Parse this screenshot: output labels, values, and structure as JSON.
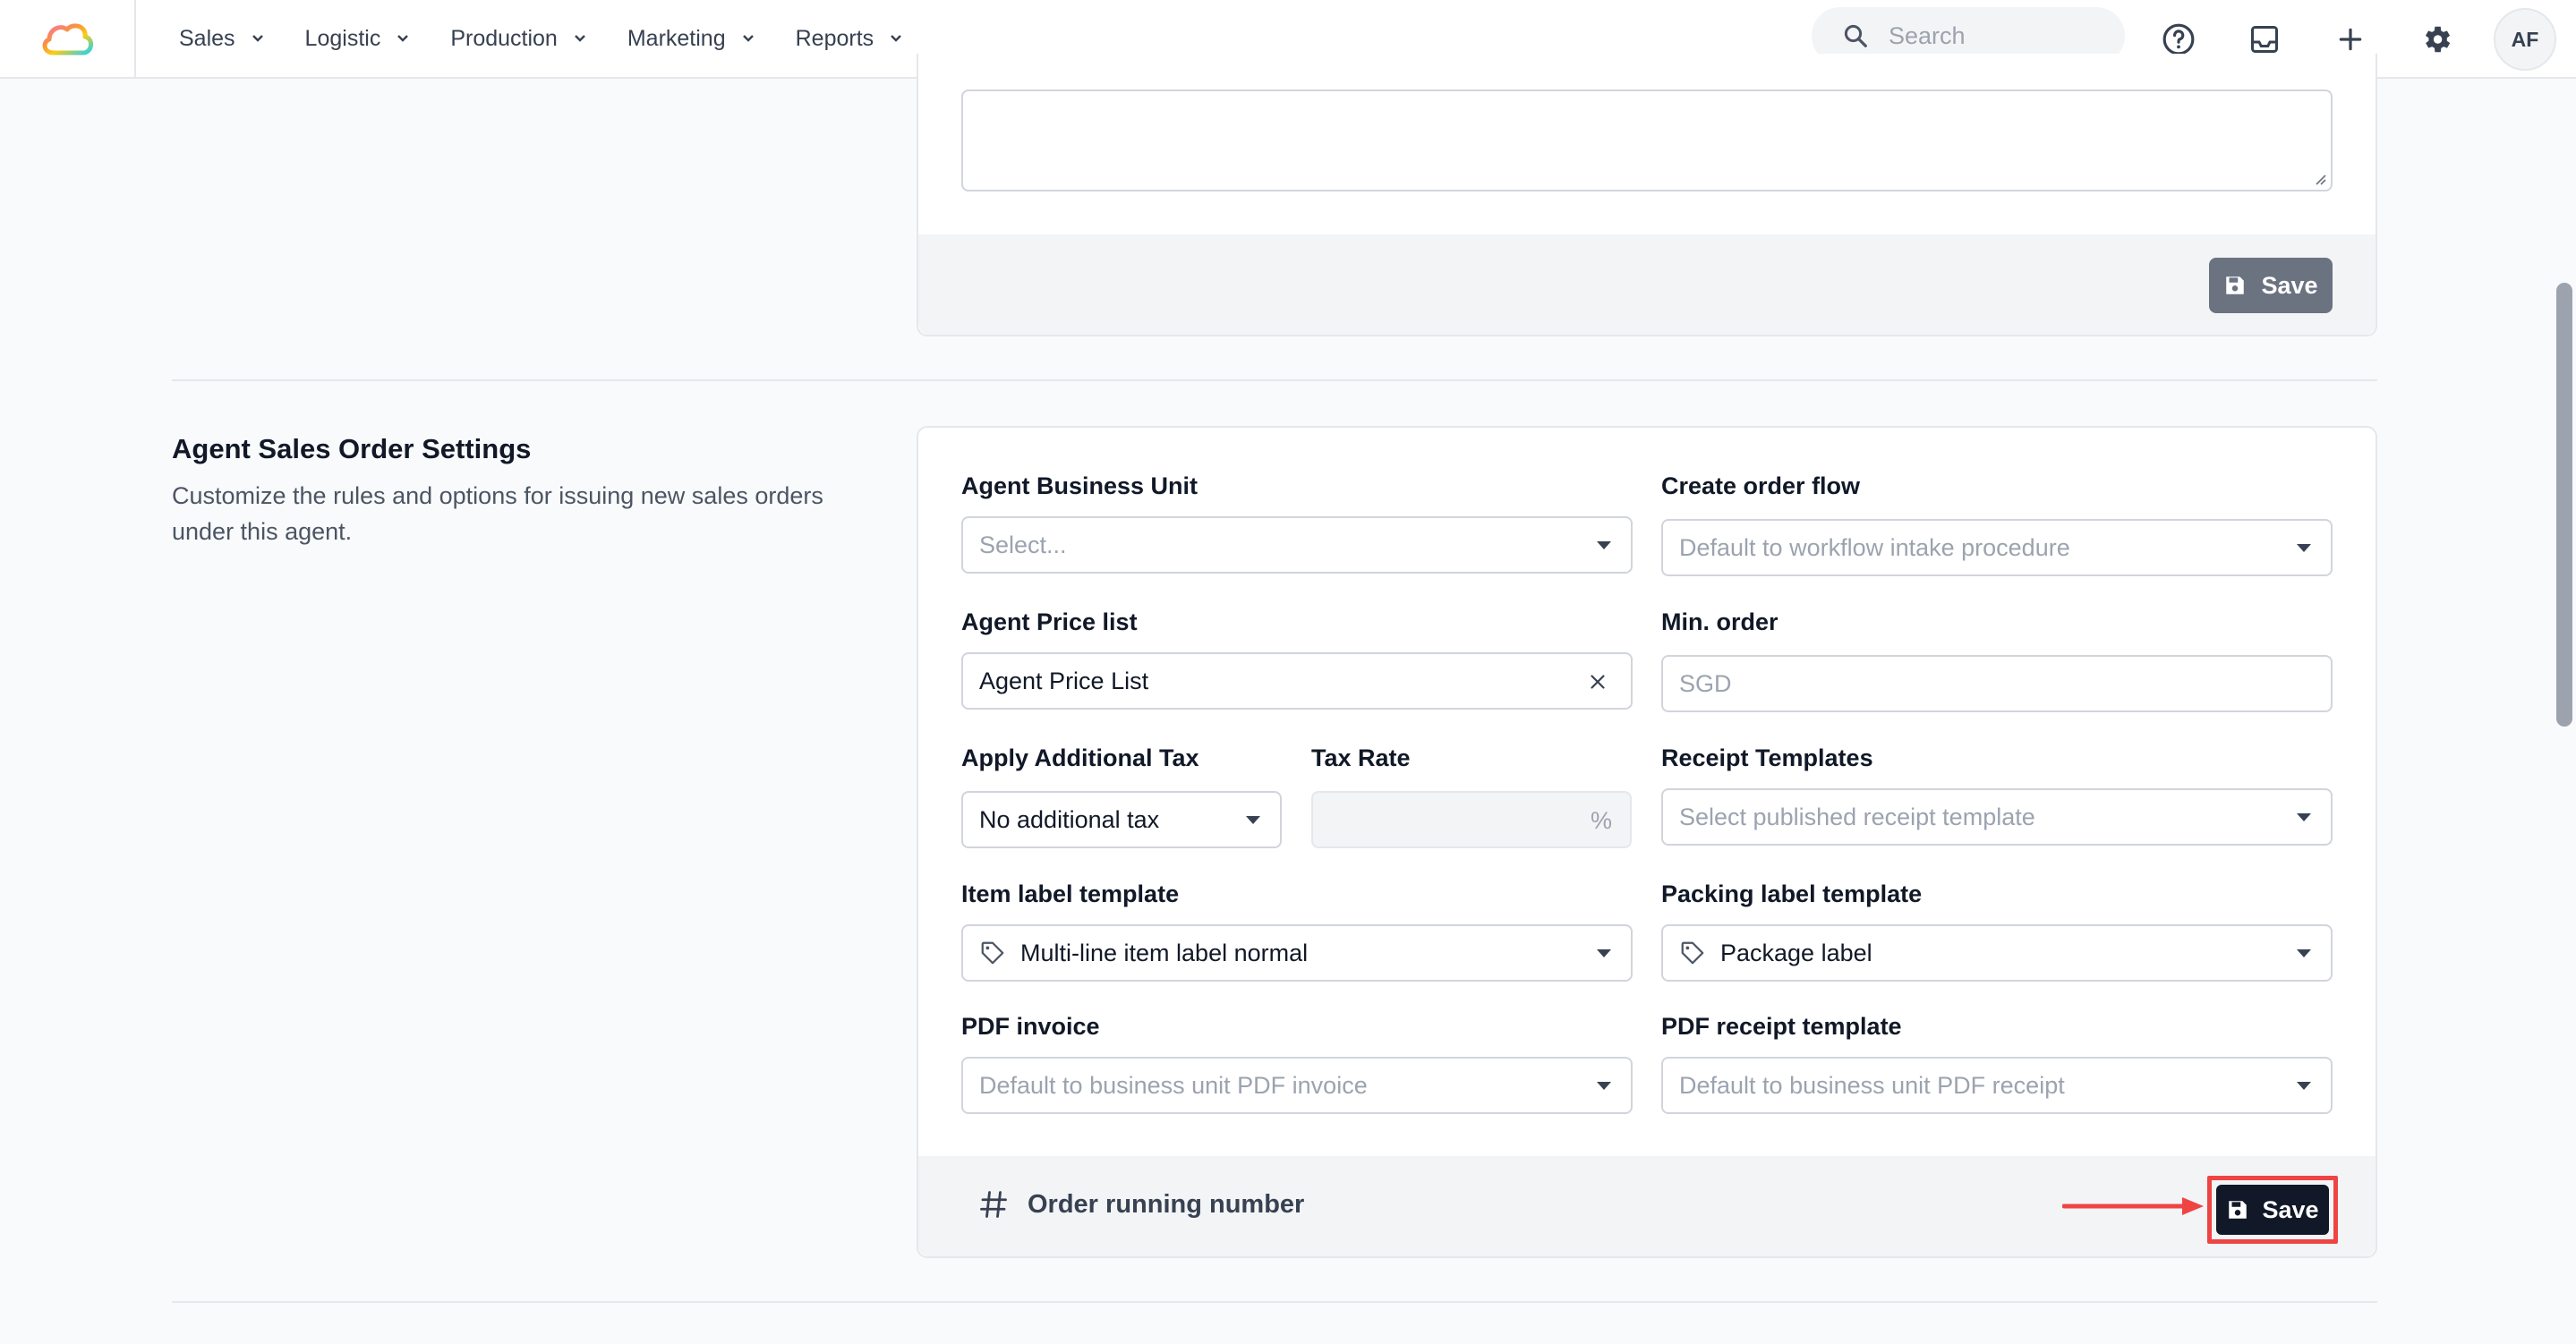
{
  "nav": {
    "items": [
      {
        "label": "Sales"
      },
      {
        "label": "Logistic"
      },
      {
        "label": "Production"
      },
      {
        "label": "Marketing"
      },
      {
        "label": "Reports"
      }
    ],
    "search_placeholder": "Search",
    "avatar_initials": "AF"
  },
  "top_card": {
    "save_label": "Save"
  },
  "section": {
    "title": "Agent Sales Order Settings",
    "description": "Customize the rules and options for issuing new sales orders under this agent."
  },
  "form": {
    "agent_business_unit": {
      "label": "Agent Business Unit",
      "placeholder": "Select..."
    },
    "create_order_flow": {
      "label": "Create order flow",
      "placeholder": "Default to workflow intake procedure"
    },
    "agent_price_list": {
      "label": "Agent Price list",
      "value": "Agent Price List"
    },
    "min_order": {
      "label": "Min. order",
      "placeholder": "SGD"
    },
    "apply_additional_tax": {
      "label": "Apply Additional Tax",
      "value": "No additional tax"
    },
    "tax_rate": {
      "label": "Tax Rate",
      "suffix": "%"
    },
    "receipt_templates": {
      "label": "Receipt Templates",
      "placeholder": "Select published receipt template"
    },
    "item_label_template": {
      "label": "Item label template",
      "value": "Multi-line item label normal"
    },
    "packing_label_template": {
      "label": "Packing label template",
      "value": "Package label"
    },
    "pdf_invoice": {
      "label": "PDF invoice",
      "placeholder": "Default to business unit PDF invoice"
    },
    "pdf_receipt_template": {
      "label": "PDF receipt template",
      "placeholder": "Default to business unit PDF receipt"
    }
  },
  "footer": {
    "running_number_label": "Order running number",
    "save_label": "Save"
  },
  "colors": {
    "highlight": "#ef4444",
    "dark_button": "#111827",
    "gray_button": "#6b7280"
  }
}
